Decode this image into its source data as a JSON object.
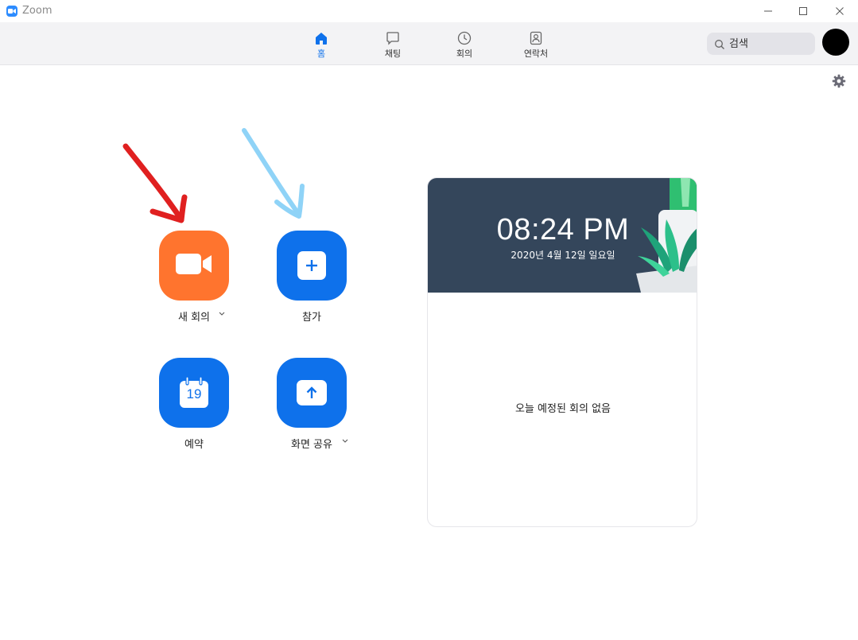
{
  "window": {
    "title": "Zoom"
  },
  "toolbar": {
    "tabs": [
      {
        "label": "홈",
        "icon": "home-icon",
        "active": true
      },
      {
        "label": "채팅",
        "icon": "chat-icon",
        "active": false
      },
      {
        "label": "회의",
        "icon": "clock-icon",
        "active": false
      },
      {
        "label": "연락처",
        "icon": "contacts-icon",
        "active": false
      }
    ],
    "search_placeholder": "검색"
  },
  "actions": {
    "new_meeting": "새 회의",
    "join": "참가",
    "schedule": "예약",
    "schedule_day": "19",
    "share_screen": "화면 공유"
  },
  "calendar": {
    "time": "08:24 PM",
    "date": "2020년 4월 12일 일요일",
    "empty_message": "오늘 예정된 회의 없음"
  },
  "colors": {
    "accent": "#0e71eb",
    "new_meeting": "#ff742e",
    "header_bg": "#34465b",
    "annotation_red": "#e02020",
    "annotation_blue": "#8fd3f7"
  }
}
